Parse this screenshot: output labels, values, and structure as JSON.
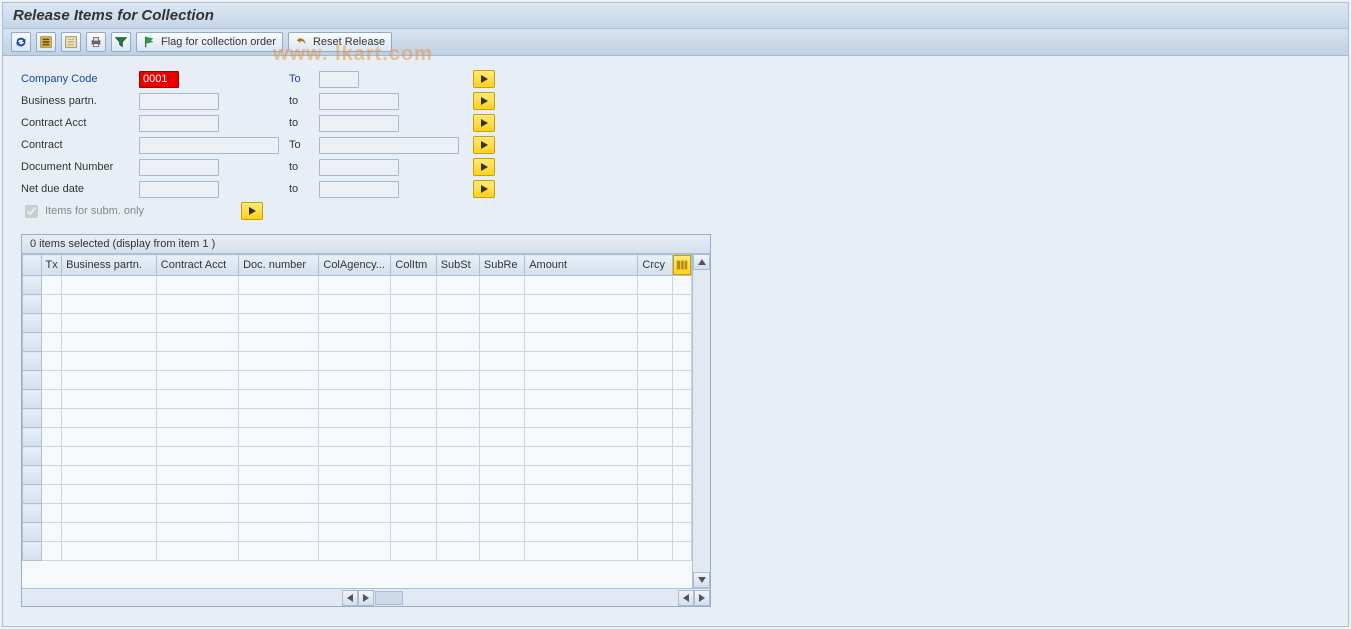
{
  "title": "Release Items for Collection",
  "toolbar": {
    "flag_label": "Flag for collection order",
    "reset_label": "Reset Release"
  },
  "watermark": "www.               lkart.com",
  "selection": {
    "rows": [
      {
        "label": "Company Code",
        "label_blue": true,
        "low": "0001",
        "low_red": true,
        "low_w": "inp-w1b",
        "to": "To",
        "to_blue": true,
        "high": "",
        "high_w": "inp-w1b"
      },
      {
        "label": "Business partn.",
        "label_blue": false,
        "low": "",
        "low_red": false,
        "low_w": "inp-w1",
        "to": "to",
        "to_blue": false,
        "high": "",
        "high_w": "inp-w1"
      },
      {
        "label": "Contract Acct",
        "label_blue": false,
        "low": "",
        "low_red": false,
        "low_w": "inp-w1",
        "to": "to",
        "to_blue": false,
        "high": "",
        "high_w": "inp-w1"
      },
      {
        "label": "Contract",
        "label_blue": false,
        "low": "",
        "low_red": false,
        "low_w": "inp-w2",
        "to": "To",
        "to_blue": false,
        "high": "",
        "high_w": "inp-w2"
      },
      {
        "label": "Document Number",
        "label_blue": false,
        "low": "",
        "low_red": false,
        "low_w": "inp-w1",
        "to": "to",
        "to_blue": false,
        "high": "",
        "high_w": "inp-w1"
      },
      {
        "label": "Net due date",
        "label_blue": false,
        "low": "",
        "low_red": false,
        "low_w": "inp-w1",
        "to": "to",
        "to_blue": false,
        "high": "",
        "high_w": "inp-w1"
      }
    ],
    "subm_only_label": "Items for subm. only",
    "subm_only_checked": true
  },
  "grid": {
    "caption": "0 items selected (display from item 1 )",
    "columns": [
      "",
      "Tx",
      "Business partn.",
      "Contract Acct",
      "Doc. number",
      "ColAgency...",
      "ColItm",
      "SubSt",
      "SubRe",
      "Amount",
      "Crcy"
    ],
    "row_count": 15
  }
}
